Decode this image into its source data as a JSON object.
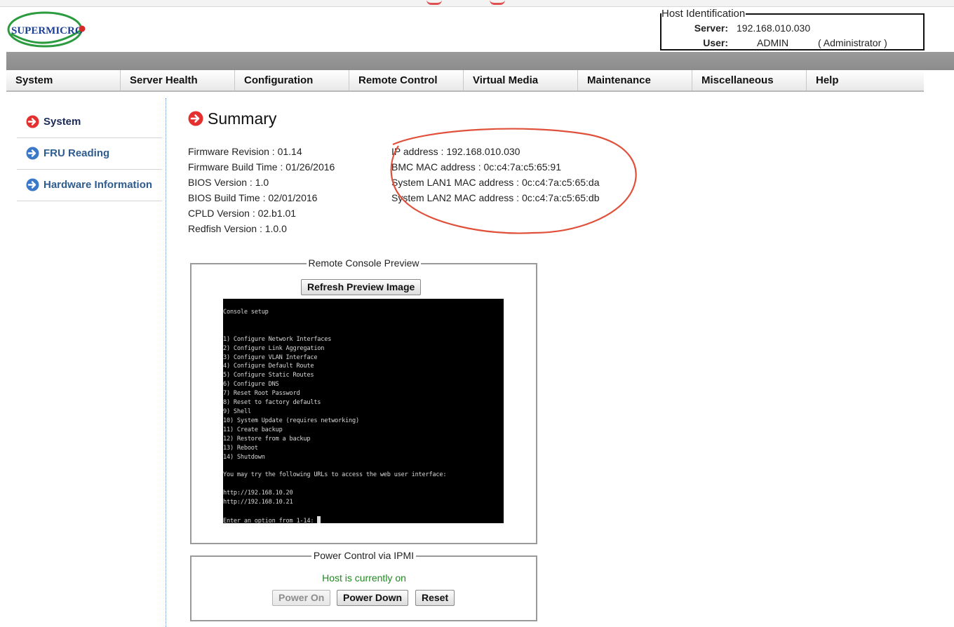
{
  "brand": {
    "logo_text": "SUPERMICRO"
  },
  "host": {
    "legend": "Host Identification",
    "server_label": "Server:",
    "server_value": "192.168.010.030",
    "user_label": "User:",
    "user_value": "ADMIN",
    "user_role": "( Administrator )"
  },
  "nav": [
    {
      "label": "System"
    },
    {
      "label": "Server Health"
    },
    {
      "label": "Configuration"
    },
    {
      "label": "Remote Control"
    },
    {
      "label": "Virtual Media"
    },
    {
      "label": "Maintenance"
    },
    {
      "label": "Miscellaneous"
    },
    {
      "label": "Help"
    }
  ],
  "sidebar": [
    {
      "label": "System",
      "icon": "red-arrow-circle-icon"
    },
    {
      "label": "FRU Reading",
      "icon": "blue-arrow-circle-icon"
    },
    {
      "label": "Hardware Information",
      "icon": "blue-arrow-circle-icon"
    }
  ],
  "page": {
    "title": "Summary"
  },
  "summary": {
    "firmware_revision": "Firmware Revision : 01.14",
    "firmware_build_time": "Firmware Build Time : 01/26/2016",
    "bios_version": "BIOS Version : 1.0",
    "bios_build_time": "BIOS Build Time : 02/01/2016",
    "cpld_version": "CPLD Version : 02.b1.01",
    "redfish_version": "Redfish Version : 1.0.0",
    "ip_address": "IP address : 192.168.010.030",
    "bmc_mac": "BMC MAC address : 0c:c4:7a:c5:65:91",
    "lan1_mac": "System LAN1 MAC address : 0c:c4:7a:c5:65:da",
    "lan2_mac": "System LAN2 MAC address : 0c:c4:7a:c5:65:db"
  },
  "preview": {
    "legend": "Remote Console Preview",
    "refresh_label": "Refresh Preview Image",
    "console_text": "Console setup\n\n\n1) Configure Network Interfaces\n2) Configure Link Aggregation\n3) Configure VLAN Interface\n4) Configure Default Route\n5) Configure Static Routes\n6) Configure DNS\n7) Reset Root Password\n8) Reset to factory defaults\n9) Shell\n10) System Update (requires networking)\n11) Create backup\n12) Restore from a backup\n13) Reboot\n14) Shutdown\n\nYou may try the following URLs to access the web user interface:\n\nhttp://192.168.10.20\nhttp://192.168.10.21\n\nEnter an option from 1-14: "
  },
  "power": {
    "legend": "Power Control via IPMI",
    "status": "Host is currently on",
    "power_on_label": "Power On",
    "power_down_label": "Power Down",
    "reset_label": "Reset"
  },
  "colors": {
    "status_green": "#1f8a1f",
    "annotation_red": "#e0503a",
    "active_icon_red": "#e53030",
    "inactive_icon_blue": "#3a78c8"
  }
}
